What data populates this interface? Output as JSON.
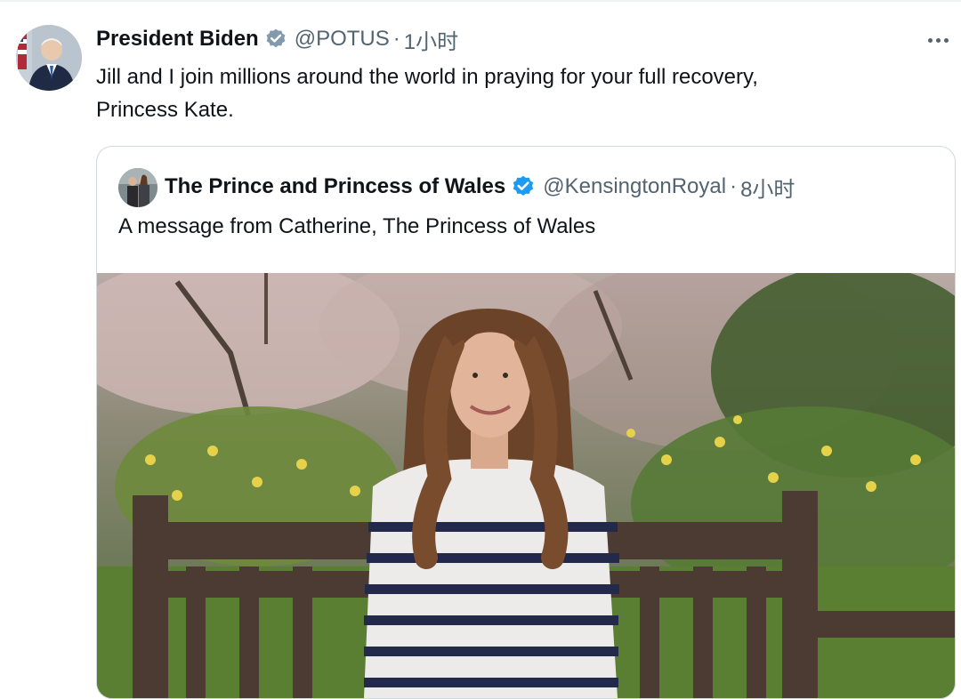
{
  "tweet": {
    "author_name": "President Biden",
    "handle": "@POTUS",
    "separator": "·",
    "time": "1小时",
    "text_line1": "Jill and I join millions around the world in praying for your full recovery,",
    "text_line2": "Princess Kate.",
    "avatar_icon": "person-avatar",
    "verified_icon": "verified-badge-gray",
    "verified_color": "#829aab",
    "more_icon": "more-horizontal-icon"
  },
  "quote": {
    "author_name": "The Prince and Princess of Wales",
    "handle": "@KensingtonRoyal",
    "separator": "·",
    "time": "8小时",
    "text": "A message from Catherine, The Princess of Wales",
    "avatar_icon": "couple-avatar",
    "verified_icon": "verified-badge-blue",
    "verified_color": "#1d9bf0",
    "media_icon": "video-thumbnail"
  },
  "colors": {
    "text_primary": "#0f1419",
    "text_secondary": "#536471",
    "border": "#cfd9de"
  }
}
